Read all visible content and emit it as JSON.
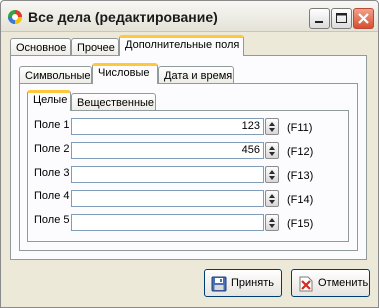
{
  "window": {
    "title": "Все дела (редактирование)"
  },
  "tabs_main": [
    {
      "label": "Основное"
    },
    {
      "label": "Прочее"
    },
    {
      "label": "Дополнительные поля",
      "active": true
    }
  ],
  "tabs_type": [
    {
      "label": "Символьные"
    },
    {
      "label": "Числовые",
      "active": true
    },
    {
      "label": "Дата и время"
    }
  ],
  "tabs_numeric": [
    {
      "label": "Целые",
      "active": true
    },
    {
      "label": "Вещественные"
    }
  ],
  "fields": [
    {
      "label": "Поле 1",
      "value": "123",
      "code": "(F11)"
    },
    {
      "label": "Поле 2",
      "value": "456",
      "code": "(F12)"
    },
    {
      "label": "Поле 3",
      "value": "",
      "code": "(F13)"
    },
    {
      "label": "Поле 4",
      "value": "",
      "code": "(F14)"
    },
    {
      "label": "Поле 5",
      "value": "",
      "code": "(F15)"
    }
  ],
  "buttons": {
    "accept_label": "Принять",
    "cancel_label": "Отменить"
  },
  "colors": {
    "active_tab_accent": "#ffc83c",
    "close_button": "#d6502f",
    "dialog_background": "#ece9d8"
  },
  "icons": {
    "app": "app-icon",
    "minimize": "minimize-icon",
    "maximize": "maximize-icon",
    "close": "close-icon",
    "accept": "floppy-disk-icon",
    "cancel": "cancel-document-icon",
    "spinner": "spinner-arrows-icon"
  }
}
